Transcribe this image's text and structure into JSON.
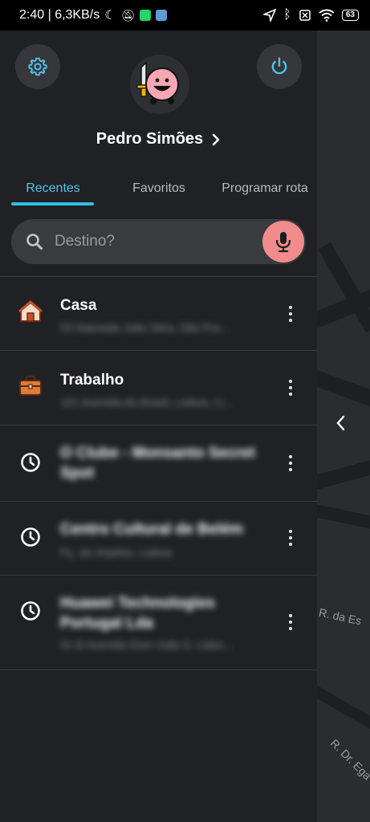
{
  "status_bar": {
    "time_speed": "2:40 | 6,3KB/s",
    "battery": "63"
  },
  "drawer": {
    "user_name": "Pedro Simões",
    "tabs": [
      {
        "label": "Recentes",
        "active": true
      },
      {
        "label": "Favoritos",
        "active": false
      },
      {
        "label": "Programar rota",
        "active": false
      }
    ],
    "search_placeholder": "Destino?",
    "items": [
      {
        "title": "Casa",
        "subtitle": "53 Alameda João Sitra, São Fra...",
        "icon": "home-icon"
      },
      {
        "title": "Trabalho",
        "subtitle": "101 Avenida do Brasil, Lisboa, Li...",
        "icon": "briefcase-icon"
      },
      {
        "title": "O Clube - Monsanto Secret Spot",
        "subtitle": "",
        "icon": "clock-icon"
      },
      {
        "title": "Centro Cultural de Belém",
        "subtitle": "Pç. do Império, Lisboa",
        "icon": "clock-icon"
      },
      {
        "title": "Huawei Technologies Portugal Lda",
        "subtitle": "51 B Avenida Dom João II, Lisbo...",
        "icon": "clock-icon"
      }
    ]
  },
  "map": {
    "street_1": "R. da Es",
    "street_2": "R. Dr. Ega"
  },
  "colors": {
    "accent": "#33bce8",
    "mic": "#f28b8b",
    "drawer_bg": "#202124"
  }
}
